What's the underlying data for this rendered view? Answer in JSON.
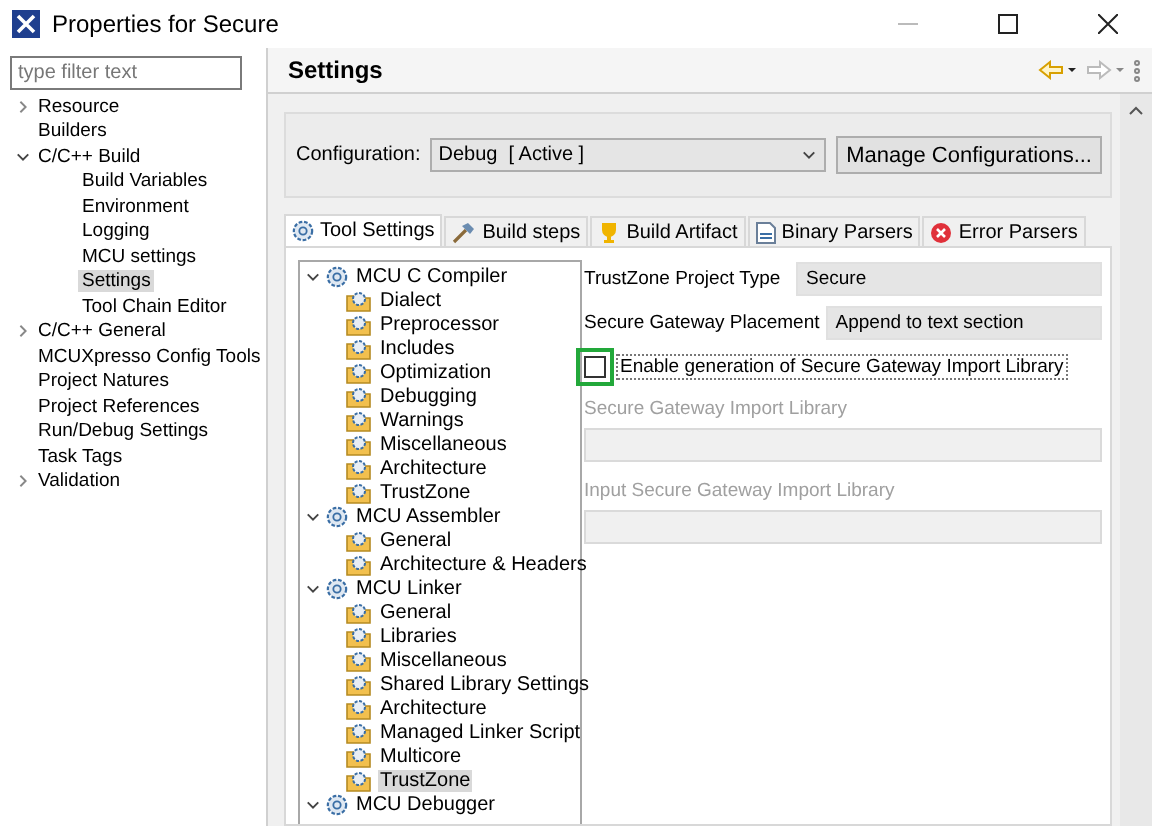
{
  "window": {
    "title": "Properties for Secure"
  },
  "filter": {
    "placeholder": "type filter text"
  },
  "nav": [
    {
      "label": "Resource",
      "expanded": false,
      "selected": false
    },
    {
      "label": "Builders",
      "selected": false
    },
    {
      "label": "C/C++ Build",
      "expanded": true,
      "selected": false,
      "children": [
        {
          "label": "Build Variables",
          "selected": false
        },
        {
          "label": "Environment",
          "selected": false
        },
        {
          "label": "Logging",
          "selected": false
        },
        {
          "label": "MCU settings",
          "selected": false
        },
        {
          "label": "Settings",
          "selected": true
        },
        {
          "label": "Tool Chain Editor",
          "selected": false
        }
      ]
    },
    {
      "label": "C/C++ General",
      "expanded": false,
      "selected": false
    },
    {
      "label": "MCUXpresso Config Tools",
      "selected": false
    },
    {
      "label": "Project Natures",
      "selected": false
    },
    {
      "label": "Project References",
      "selected": false
    },
    {
      "label": "Run/Debug Settings",
      "selected": false
    },
    {
      "label": "Task Tags",
      "selected": false
    },
    {
      "label": "Validation",
      "expanded": false,
      "selected": false
    }
  ],
  "page": {
    "title": "Settings"
  },
  "configuration": {
    "label": "Configuration:",
    "value": "Debug  [ Active ]",
    "button": "Manage Configurations..."
  },
  "tabs": [
    {
      "label": "Tool Settings",
      "kind": "gear",
      "selected": true
    },
    {
      "label": "Build steps",
      "kind": "hammer",
      "selected": false
    },
    {
      "label": "Build Artifact",
      "kind": "trophy",
      "selected": false
    },
    {
      "label": "Binary Parsers",
      "kind": "binary",
      "selected": false
    },
    {
      "label": "Error Parsers",
      "kind": "error",
      "selected": false
    }
  ],
  "tools": [
    {
      "label": "MCU C Compiler",
      "expanded": true,
      "children": [
        {
          "label": "Dialect",
          "selected": false
        },
        {
          "label": "Preprocessor",
          "selected": false
        },
        {
          "label": "Includes",
          "selected": false
        },
        {
          "label": "Optimization",
          "selected": false
        },
        {
          "label": "Debugging",
          "selected": false
        },
        {
          "label": "Warnings",
          "selected": false
        },
        {
          "label": "Miscellaneous",
          "selected": false
        },
        {
          "label": "Architecture",
          "selected": false
        },
        {
          "label": "TrustZone",
          "selected": false
        }
      ]
    },
    {
      "label": "MCU Assembler",
      "expanded": true,
      "children": [
        {
          "label": "General",
          "selected": false
        },
        {
          "label": "Architecture & Headers",
          "selected": false
        }
      ]
    },
    {
      "label": "MCU Linker",
      "expanded": true,
      "children": [
        {
          "label": "General",
          "selected": false
        },
        {
          "label": "Libraries",
          "selected": false
        },
        {
          "label": "Miscellaneous",
          "selected": false
        },
        {
          "label": "Shared Library Settings",
          "selected": false
        },
        {
          "label": "Architecture",
          "selected": false
        },
        {
          "label": "Managed Linker Script",
          "selected": false
        },
        {
          "label": "Multicore",
          "selected": false
        },
        {
          "label": "TrustZone",
          "selected": true
        }
      ]
    },
    {
      "label": "MCU Debugger",
      "expanded": true
    }
  ],
  "options": [
    {
      "kind": "combo",
      "label": "TrustZone Project Type",
      "value": "Secure",
      "disabled": false
    },
    {
      "kind": "combo",
      "label": "Secure Gateway Placement",
      "value": "Append to text section",
      "disabled": false
    },
    {
      "kind": "checkbox",
      "label": "Enable generation of Secure Gateway Import Library",
      "checked": false,
      "highlighted": true,
      "disabled": false
    },
    {
      "kind": "text",
      "label": "Secure Gateway Import Library",
      "disabled": true
    },
    {
      "kind": "text",
      "label": "Input Secure Gateway Import Library",
      "disabled": true
    }
  ]
}
